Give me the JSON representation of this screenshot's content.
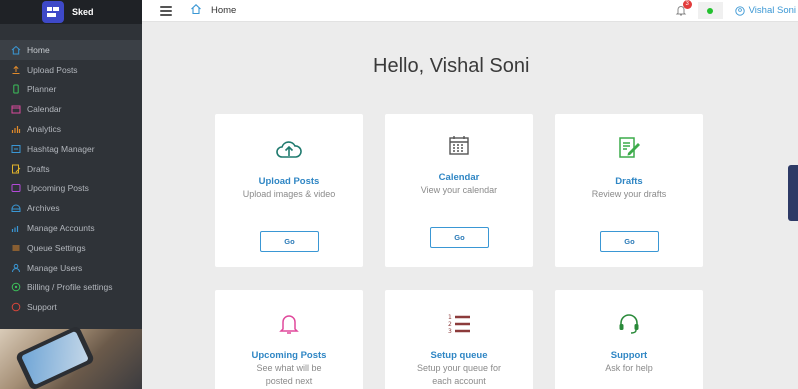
{
  "brand": {
    "name": "Sked"
  },
  "sidebar": {
    "items": [
      {
        "label": "Home",
        "icon": "home-icon",
        "color": "#3a97d4",
        "active": true
      },
      {
        "label": "Upload Posts",
        "icon": "upload-icon",
        "color": "#e08a2b"
      },
      {
        "label": "Planner",
        "icon": "phone-icon",
        "color": "#3cbf5a"
      },
      {
        "label": "Calendar",
        "icon": "calendar-icon",
        "color": "#d94a9b"
      },
      {
        "label": "Analytics",
        "icon": "chart-icon",
        "color": "#e08a2b"
      },
      {
        "label": "Hashtag Manager",
        "icon": "hashtag-icon",
        "color": "#3a97d4"
      },
      {
        "label": "Drafts",
        "icon": "drafts-icon",
        "color": "#e0b32b"
      },
      {
        "label": "Upcoming Posts",
        "icon": "clock-icon",
        "color": "#b34ad9"
      },
      {
        "label": "Archives",
        "icon": "archive-icon",
        "color": "#3a97d4"
      },
      {
        "label": "Manage Accounts",
        "icon": "accounts-icon",
        "color": "#3a97d4"
      },
      {
        "label": "Queue Settings",
        "icon": "queue-icon",
        "color": "#e08a2b"
      },
      {
        "label": "Manage Users",
        "icon": "users-icon",
        "color": "#3a97d4"
      },
      {
        "label": "Billing / Profile settings",
        "icon": "billing-icon",
        "color": "#3cbf5a"
      },
      {
        "label": "Support",
        "icon": "support-icon",
        "color": "#d9463a"
      }
    ]
  },
  "topbar": {
    "breadcrumb": "Home",
    "notifications": "3",
    "user_name": "Vishal Soni"
  },
  "main": {
    "greeting": "Hello, Vishal Soni",
    "cards": [
      {
        "title": "Upload Posts",
        "subtitle": "Upload images & video",
        "button": "Go",
        "icon": "cloud-upload-icon",
        "icon_color": "#1f7a6e"
      },
      {
        "title": "Calendar",
        "subtitle": "View your calendar",
        "button": "Go",
        "icon": "calendar-grid-icon",
        "icon_color": "#555555"
      },
      {
        "title": "Drafts",
        "subtitle": "Review your drafts",
        "button": "Go",
        "icon": "drafts-edit-icon",
        "icon_color": "#3cab4a"
      },
      {
        "title": "Upcoming Posts",
        "subtitle": "See what will be posted next",
        "icon": "bell-outline-icon",
        "icon_color": "#e0499c"
      },
      {
        "title": "Setup queue",
        "subtitle": "Setup your queue for each account",
        "icon": "numbered-list-icon",
        "icon_color": "#8c3b3b"
      },
      {
        "title": "Support",
        "subtitle": "Ask for help",
        "icon": "headset-icon",
        "icon_color": "#2a8a3a"
      }
    ]
  }
}
